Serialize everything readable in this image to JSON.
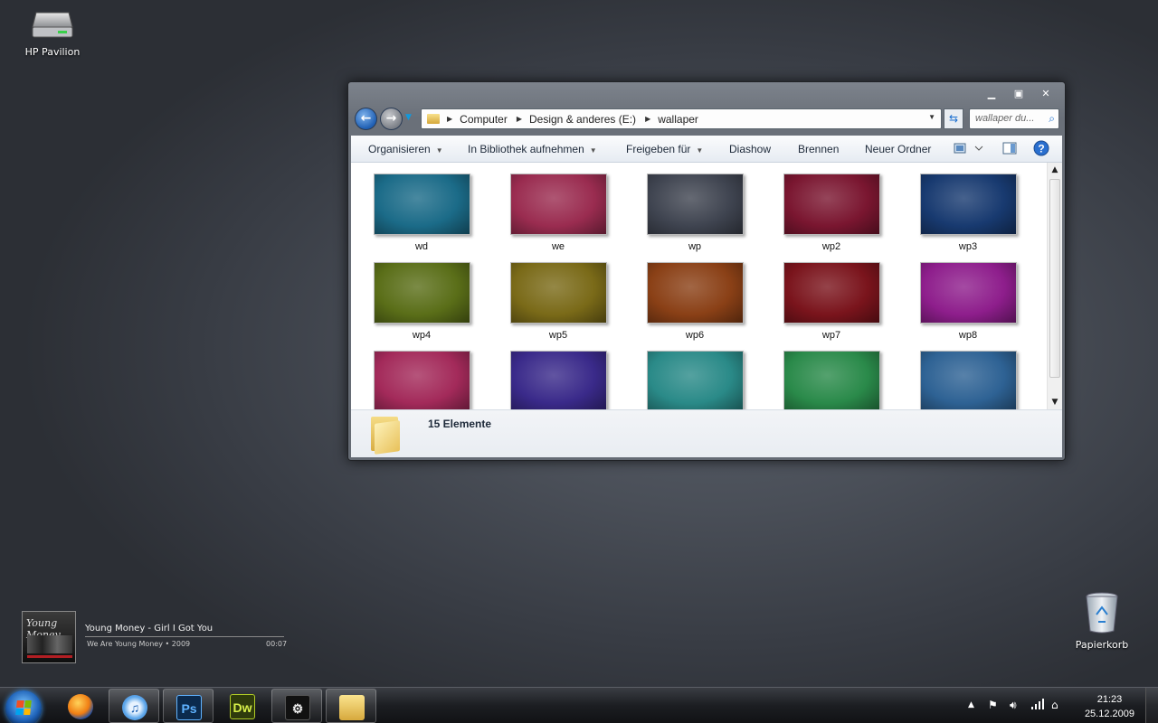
{
  "desktop": {
    "icons": [
      {
        "label": "HP Pavilion",
        "icon": "hard-drive-icon"
      },
      {
        "label": "Papierkorb",
        "icon": "recycle-bin-icon"
      }
    ]
  },
  "explorer": {
    "address": {
      "crumbs": [
        "Computer",
        "Design & anderes (E:)",
        "wallaper"
      ]
    },
    "search_placeholder": "wallaper du...",
    "commands": [
      "Organisieren",
      "In Bibliothek aufnehmen",
      "Freigeben für",
      "Diashow",
      "Brennen",
      "Neuer Ordner"
    ],
    "items": [
      {
        "name": "wd",
        "color": "#1b6b88"
      },
      {
        "name": "we",
        "color": "#9a2c50"
      },
      {
        "name": "wp",
        "color": "#3f4450"
      },
      {
        "name": "wp2",
        "color": "#7a1630"
      },
      {
        "name": "wp3",
        "color": "#183a70"
      },
      {
        "name": "wp4",
        "color": "#5a6e18"
      },
      {
        "name": "wp5",
        "color": "#7a6a18"
      },
      {
        "name": "wp6",
        "color": "#8a4016"
      },
      {
        "name": "wp7",
        "color": "#7a141c"
      },
      {
        "name": "wp8",
        "color": "#8e1e8c"
      },
      {
        "name": "",
        "color": "#a32a5a"
      },
      {
        "name": "",
        "color": "#3a2a8a"
      },
      {
        "name": "",
        "color": "#2a8a88"
      },
      {
        "name": "",
        "color": "#2a8a4a"
      },
      {
        "name": "",
        "color": "#2e6294"
      }
    ],
    "status": "15 Elemente"
  },
  "media": {
    "album_art_text": "Young Money",
    "song": "Young Money - Girl I Got You",
    "album": "We Are Young Money • 2009",
    "time": "00:07"
  },
  "taskbar": {
    "apps": [
      {
        "name": "firefox",
        "glyph": ""
      },
      {
        "name": "itunes",
        "glyph": "♫"
      },
      {
        "name": "photoshop",
        "glyph": "Ps"
      },
      {
        "name": "dreamweaver",
        "glyph": "Dw"
      },
      {
        "name": "steam",
        "glyph": "⚙"
      },
      {
        "name": "explorer",
        "glyph": ""
      }
    ],
    "clock_time": "21:23",
    "clock_date": "25.12.2009"
  }
}
